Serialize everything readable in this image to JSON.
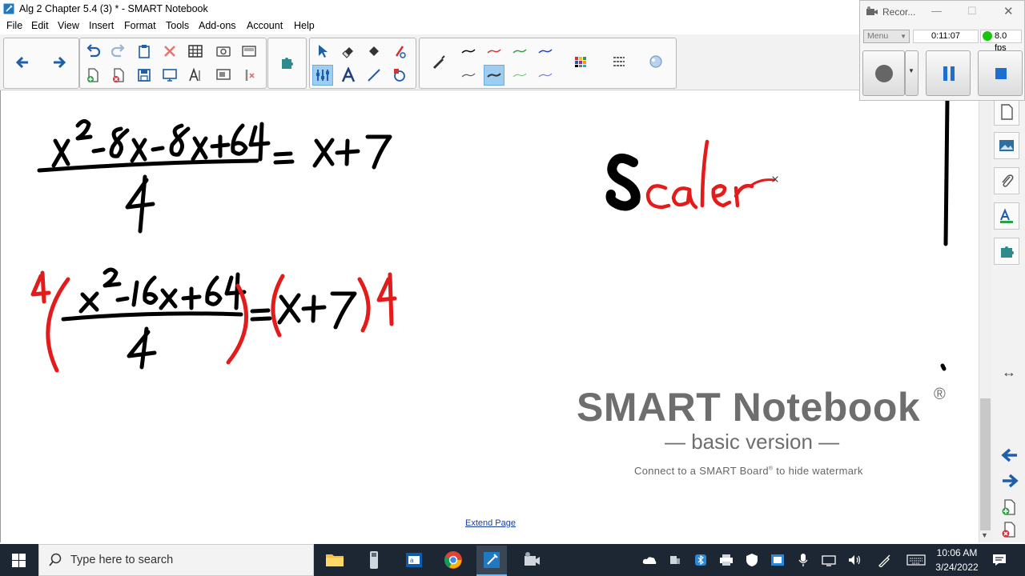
{
  "window": {
    "title": "Alg 2 Chapter 5.4 (3) * - SMART Notebook"
  },
  "menu": [
    "File",
    "Edit",
    "View",
    "Insert",
    "Format",
    "Tools",
    "Add-ons",
    "Account",
    "Help"
  ],
  "watermark": {
    "title": "SMART Notebook",
    "registered": "®",
    "subtitle": "— basic version —",
    "connect": "Connect to a SMART Board",
    "connect_sup": "®",
    "connect_rest": " to hide watermark"
  },
  "extend_page": "Extend Page",
  "recorder": {
    "title": "Recor...",
    "menu_label": "Menu",
    "elapsed": "0:11:07",
    "fps": "8.0 fps"
  },
  "taskbar": {
    "search_placeholder": "Type here to search",
    "time": "10:06 AM",
    "date": "3/24/2022"
  },
  "colors": {
    "ink_black": "#000000",
    "ink_red": "#e41b1b",
    "taskbar": "#1d2633",
    "accent_blue": "#1f6fd1",
    "link": "#1a3f9e"
  },
  "icons": {
    "toolbar": [
      "back-arrow-icon",
      "forward-arrow-icon",
      "undo-icon",
      "redo-icon",
      "paste-icon",
      "delete-icon",
      "table-icon",
      "screen-capture-icon",
      "screen-shade-icon",
      "add-page-icon",
      "delete-page-icon",
      "save-icon",
      "display-icon",
      "fit-icon",
      "view-screens-icon",
      "clear-page-icon",
      "add-ons-icon",
      "select-icon",
      "eraser-icon",
      "fill-icon",
      "magic-pen-icon",
      "adjust-tool-icon",
      "text-icon",
      "line-icon",
      "shapes-icon",
      "pen-icon",
      "pen-style-icon",
      "color-palette-icon",
      "line-properties-icon",
      "properties-icon"
    ],
    "side": [
      "page-sorter-icon",
      "gallery-icon",
      "attachments-icon",
      "properties-icon",
      "add-ons-icon",
      "expand-icon",
      "previous-page-icon",
      "next-page-icon",
      "add-page-icon",
      "delete-page-icon"
    ],
    "tray": [
      "onedrive-icon",
      "network-icon",
      "bluetooth-icon",
      "printer-icon",
      "shield-icon",
      "screen-icon",
      "microphone-icon",
      "wifi-icon",
      "volume-icon",
      "pen-icon",
      "keyboard-icon",
      "notifications-icon"
    ]
  }
}
